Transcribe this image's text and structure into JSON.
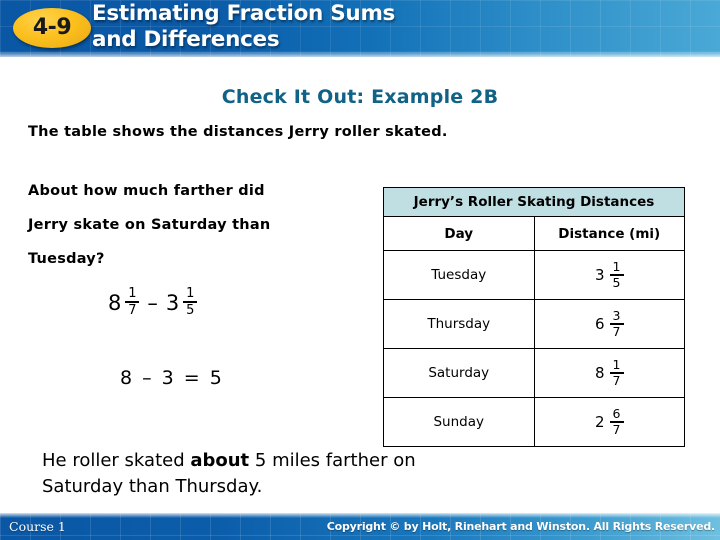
{
  "header": {
    "lesson_number": "4-9",
    "title_line1": "Estimating Fraction Sums",
    "title_line2": "and Differences",
    "bar_color": "#0a57a5",
    "badge_color": "#fcc01e"
  },
  "slide": {
    "example_heading": "Check It Out: Example 2B",
    "example_heading_color": "#106287",
    "intro_text": "The table shows the distances Jerry roller skated.",
    "question_lines": [
      "About how much farther did",
      "Jerry skate on Saturday than",
      "Tuesday?"
    ],
    "work": {
      "expression": {
        "term1": {
          "whole": "8",
          "numerator": "1",
          "denominator": "7"
        },
        "operator": "–",
        "term2": {
          "whole": "3",
          "numerator": "1",
          "denominator": "5"
        }
      },
      "answer_line": "8 – 3 = 5"
    },
    "conclusion": {
      "part1": "He roller skated ",
      "emphasis": "about",
      "part2": " 5 miles farther on",
      "line2": "Saturday than Thursday."
    }
  },
  "table": {
    "caption": "Jerry’s Roller Skating Distances",
    "caption_bg": "#bfdfe3",
    "columns": [
      "Day",
      "Distance (mi)"
    ],
    "rows": [
      {
        "day": "Tuesday",
        "whole": "3",
        "numerator": "1",
        "denominator": "5"
      },
      {
        "day": "Thursday",
        "whole": "6",
        "numerator": "3",
        "denominator": "7"
      },
      {
        "day": "Saturday",
        "whole": "8",
        "numerator": "1",
        "denominator": "7"
      },
      {
        "day": "Sunday",
        "whole": "2",
        "numerator": "6",
        "denominator": "7"
      }
    ]
  },
  "footer": {
    "course": "Course 1",
    "copyright": "Copyright © by Holt, Rinehart and Winston. All Rights Reserved."
  }
}
